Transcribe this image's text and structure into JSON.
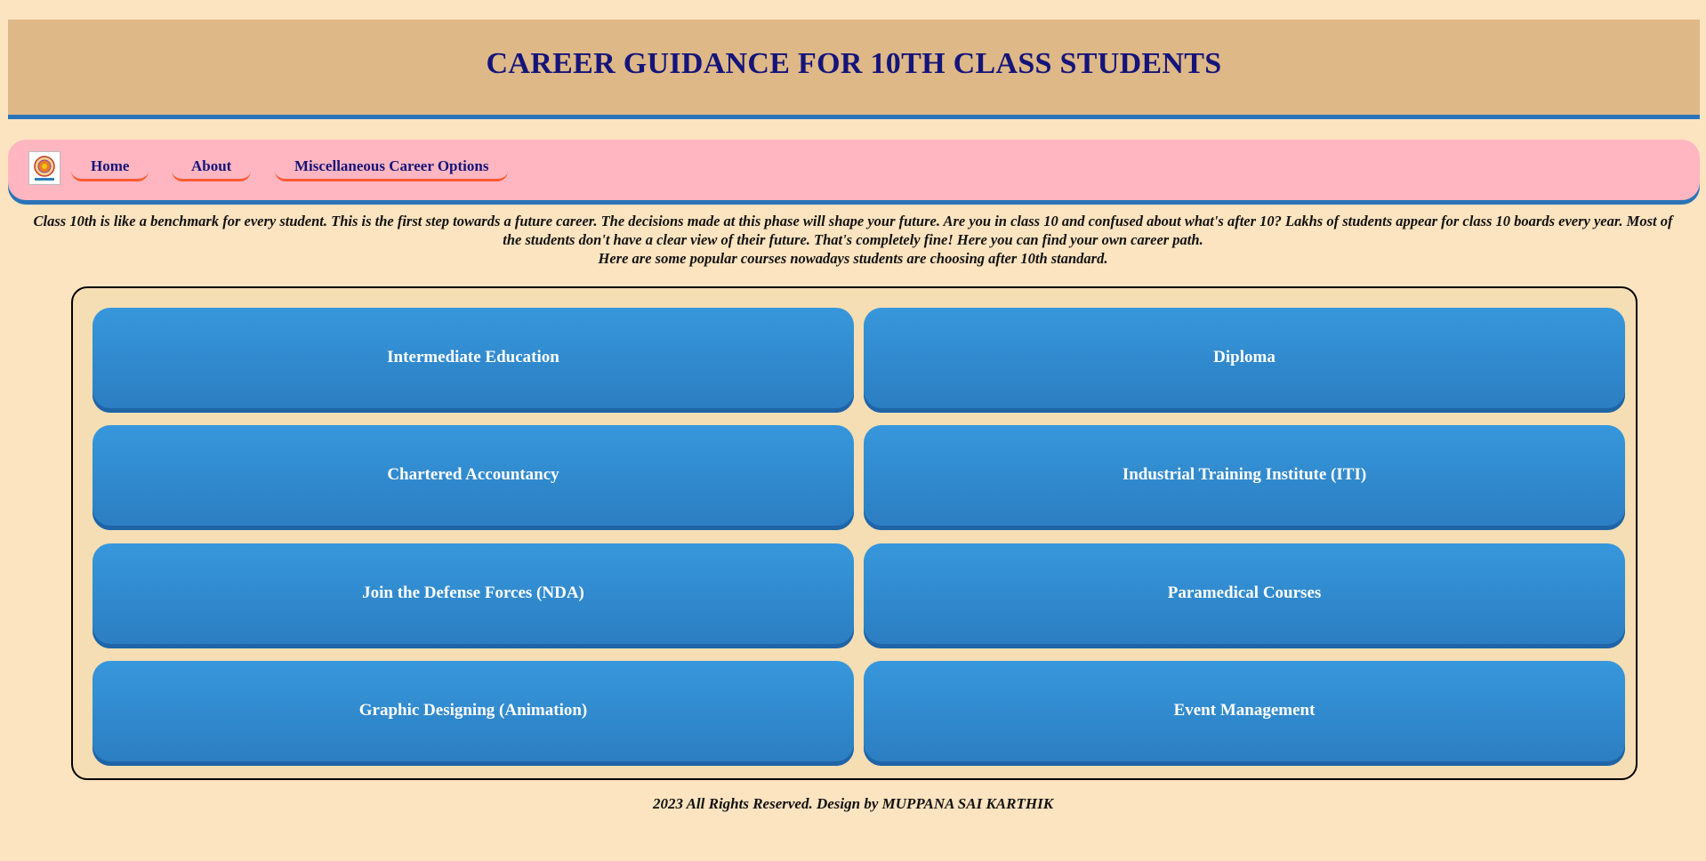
{
  "header": {
    "title": "CAREER GUIDANCE FOR 10TH CLASS STUDENTS"
  },
  "nav": {
    "logo_icon": "college-emblem-icon",
    "links": [
      {
        "label": "Home"
      },
      {
        "label": "About"
      },
      {
        "label": "Miscellaneous Career Options"
      }
    ]
  },
  "intro": {
    "paragraph": "Class 10th is like a benchmark for every student. This is the first step towards a future career. The decisions made at this phase will shape your future. Are you in class 10 and confused about what's after 10? Lakhs of students appear for class 10 boards every year. Most of the students don't have a clear view of their future. That's completely fine! Here you can find your own career path.",
    "subline": "Here are some popular courses nowadays students are choosing after 10th standard."
  },
  "courses": [
    {
      "label": "Intermediate Education"
    },
    {
      "label": "Diploma"
    },
    {
      "label": "Chartered Accountancy"
    },
    {
      "label": "Industrial Training Institute (ITI)"
    },
    {
      "label": "Join the Defense Forces (NDA)"
    },
    {
      "label": "Paramedical Courses"
    },
    {
      "label": "Graphic Designing (Animation)"
    },
    {
      "label": "Event Management"
    }
  ],
  "footer": {
    "text": "2023 All Rights Reserved. Design by MUPPANA SAI KARTHIK"
  },
  "colors": {
    "page_background": "#fde4c0",
    "header_background": "#deb887",
    "accent_blue": "#2a73b8",
    "nav_background": "#ffb6c1",
    "nav_underline": "#ff5a2e",
    "title_text": "#14147a",
    "course_button": "#3797dc",
    "course_panel": "#f5deb3"
  }
}
